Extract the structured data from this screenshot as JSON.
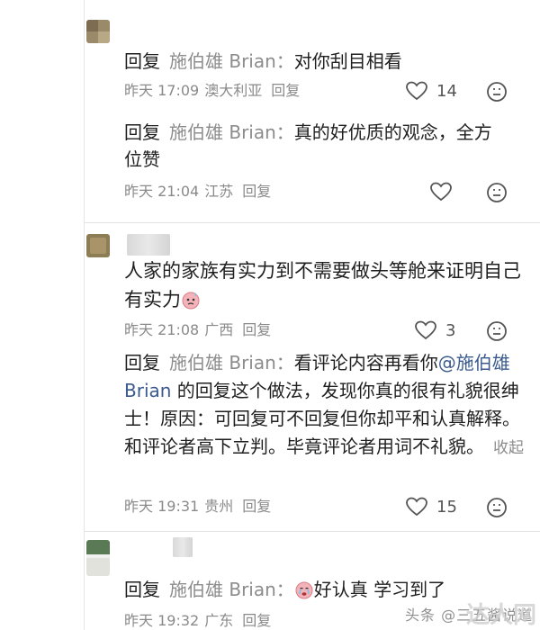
{
  "ui": {
    "reply_keyword": "回复",
    "reply_action": "回复",
    "fold_label": "收起"
  },
  "blocks": [
    {
      "author": "施伯雄 Brian",
      "text": "对你刮目相看",
      "time": "昨天 17:09",
      "location": "澳大利亚",
      "likes": "14"
    },
    {
      "author": "施伯雄 Brian",
      "text": "真的好优质的观念，全方位赞",
      "time": "昨天 21:04",
      "location": "江苏",
      "likes": ""
    },
    {
      "text": "人家的家族有实力到不需要做头等舱来证明自己有实力",
      "time": "昨天 21:08",
      "location": "广西",
      "likes": "3"
    },
    {
      "author": "施伯雄 Brian",
      "text_pre": "看评论内容再看你",
      "mention": "@施伯雄 Brian",
      "text_post": " 的回复这个做法，发现你真的很有礼貌很绅士！原因：可回复可不回复但你却平和认真解释。和评论者高下立判。毕竟评论者用词不礼貌。",
      "time": "昨天 19:31",
      "location": "贵州",
      "likes": "15"
    },
    {
      "author": "施伯雄 Brian",
      "text": "好认真 学习到了",
      "time": "昨天 19:32",
      "location": "广东",
      "likes": ""
    }
  ],
  "watermark": {
    "source": "头条 @三五酱说道",
    "site": "达人网"
  }
}
